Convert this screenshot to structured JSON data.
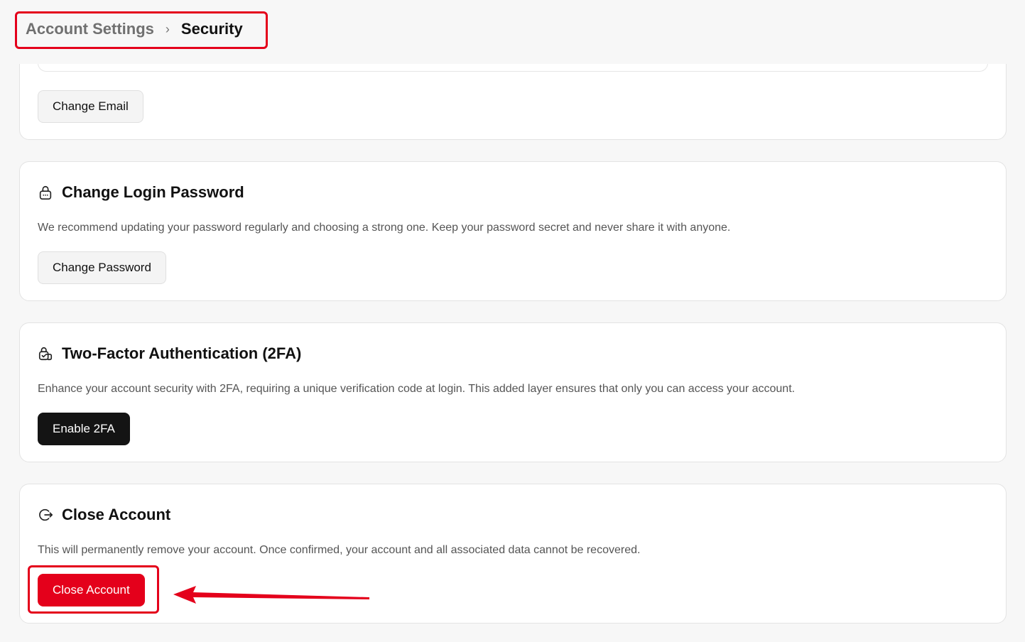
{
  "breadcrumb": {
    "parent": "Account Settings",
    "separator": "›",
    "current": "Security"
  },
  "email_section": {
    "button_label": "Change Email"
  },
  "password_section": {
    "icon": "lock-icon",
    "title": "Change Login Password",
    "description": "We recommend updating your password regularly and choosing a strong one. Keep your password secret and never share it with anyone.",
    "button_label": "Change Password"
  },
  "twofa_section": {
    "icon": "shield-lock-icon",
    "title": "Two-Factor Authentication (2FA)",
    "description": "Enhance your account security with 2FA, requiring a unique verification code at login. This added layer ensures that only you can access your account.",
    "button_label": "Enable 2FA"
  },
  "close_section": {
    "icon": "logout-icon",
    "title": "Close Account",
    "description": "This will permanently remove your account. Once confirmed, your account and all associated data cannot be recovered.",
    "button_label": "Close Account"
  },
  "colors": {
    "page_background": "#f7f7f7",
    "danger": "#e4001b",
    "primary_dark": "#141414",
    "annotation": "#e4001b"
  }
}
